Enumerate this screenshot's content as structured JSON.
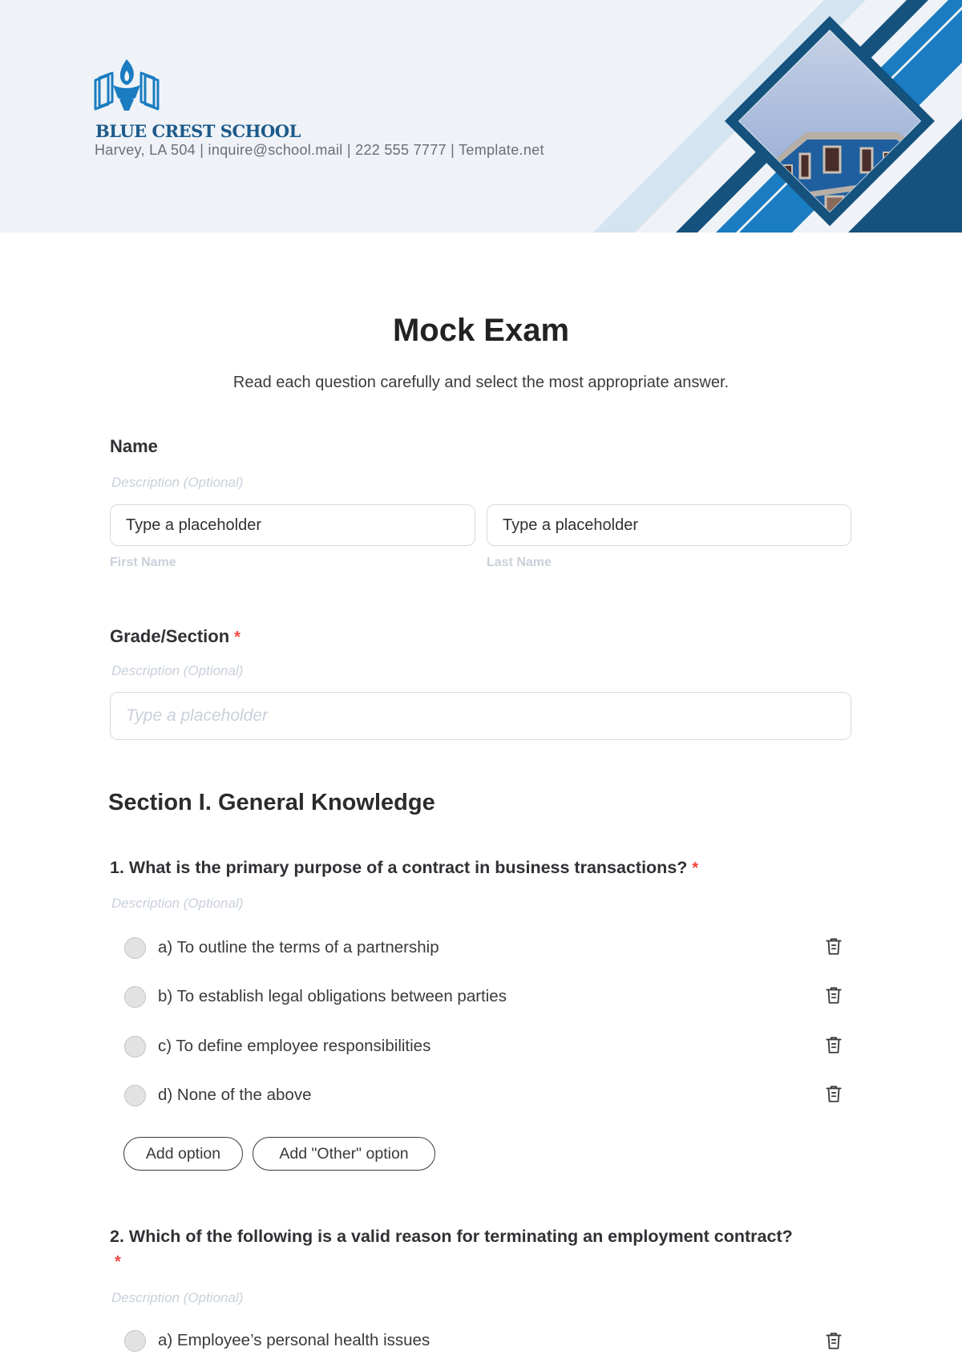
{
  "header": {
    "logo_icon": "torch-book-icon",
    "school_name": "BLUE CREST SCHOOL",
    "contact_line": "Harvey, LA 504 | inquire@school.mail | 222 555 7777 | Template.net",
    "colors": {
      "brand_dark": "#15527d",
      "brand_bright": "#1a7cc1",
      "brand_light": "#d4e4f1",
      "header_bg": "#eff3f7"
    }
  },
  "form": {
    "title": "Mock Exam",
    "subtitle": "Read each question carefully and select the most appropriate answer.",
    "name_field": {
      "label": "Name",
      "description": "Description (Optional)",
      "first": {
        "value": "Type a placeholder",
        "sublabel": "First Name"
      },
      "last": {
        "value": "Type a placeholder",
        "sublabel": "Last Name"
      }
    },
    "grade_field": {
      "label": "Grade/Section",
      "required_mark": "*",
      "description": "Description (Optional)",
      "placeholder": "Type a placeholder"
    },
    "section_title": "Section I. General Knowledge",
    "questions": [
      {
        "text": "1. What is the primary purpose of a contract in business transactions?",
        "required_mark": "*",
        "description": "Description (Optional)",
        "options": [
          "a) To outline the terms of a partnership",
          "b) To establish legal obligations between parties",
          "c) To define employee responsibilities",
          "d) None of the above"
        ],
        "add_option_label": "Add option",
        "add_other_label": "Add \"Other\" option"
      },
      {
        "text": "2. Which of the following is a valid reason for terminating an employment contract?",
        "required_mark": "*",
        "description": "Description (Optional)",
        "options": [
          "a) Employee’s personal health issues"
        ]
      }
    ],
    "icons": {
      "delete": "trash-icon",
      "radio": "radio-unselected"
    },
    "colors": {
      "required": "#f2473f",
      "muted": "#c9d0da"
    }
  }
}
